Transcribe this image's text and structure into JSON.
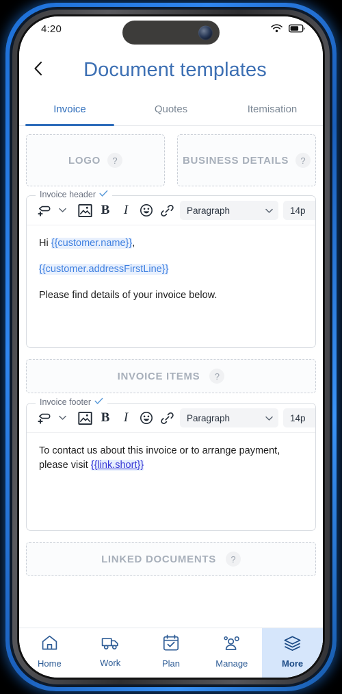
{
  "status_bar": {
    "time": "4:20",
    "wifi_icon": "wifi-icon",
    "battery_icon": "battery-icon"
  },
  "header": {
    "back_icon": "chevron-left-icon",
    "title": "Document templates"
  },
  "tabs": [
    {
      "label": "Invoice",
      "active": true
    },
    {
      "label": "Quotes",
      "active": false
    },
    {
      "label": "Itemisation",
      "active": false
    }
  ],
  "sections": {
    "logo": {
      "label": "LOGO",
      "help": "?"
    },
    "business_details": {
      "label": "BUSINESS DETAILS",
      "help": "?"
    },
    "invoice_items": {
      "label": "INVOICE ITEMS",
      "help": "?"
    },
    "linked_documents": {
      "label": "LINKED DOCUMENTS",
      "help": "?"
    }
  },
  "editors": [
    {
      "legend": "Invoice header",
      "legend_icon": "check-icon",
      "toolbar": {
        "merge_tag_icon": "tag-plus-icon",
        "merge_tag_chevron": "chevron-down-icon",
        "image_icon": "image-icon",
        "bold_label": "B",
        "italic_label": "I",
        "emoji_icon": "smiley-icon",
        "link_icon": "link-icon",
        "style_value": "Paragraph",
        "style_chevron": "chevron-down-icon",
        "font_size_value": "14p"
      },
      "body": {
        "line1_prefix": "Hi ",
        "line1_tag": "{{customer.name}}",
        "line1_suffix": ",",
        "line2_tag": "{{customer.addressFirstLine}}",
        "line3": "Please find details of your invoice below."
      }
    },
    {
      "legend": "Invoice footer",
      "legend_icon": "check-icon",
      "toolbar": {
        "merge_tag_icon": "tag-plus-icon",
        "merge_tag_chevron": "chevron-down-icon",
        "image_icon": "image-icon",
        "bold_label": "B",
        "italic_label": "I",
        "emoji_icon": "smiley-icon",
        "link_icon": "link-icon",
        "style_value": "Paragraph",
        "style_chevron": "chevron-down-icon",
        "font_size_value": "14p"
      },
      "body": {
        "line1": "To contact us about this invoice or to arrange payment, please visit ",
        "line1_tag": "{{link.short}}"
      }
    }
  ],
  "bottom_nav": [
    {
      "label": "Home",
      "icon": "home-icon",
      "active": false
    },
    {
      "label": "Work",
      "icon": "truck-icon",
      "active": false
    },
    {
      "label": "Plan",
      "icon": "calendar-check-icon",
      "active": false
    },
    {
      "label": "Manage",
      "icon": "people-icon",
      "active": false
    },
    {
      "label": "More",
      "icon": "layers-icon",
      "active": true
    }
  ],
  "colors": {
    "accent_blue": "#2e6dbb",
    "title_blue": "#3c6fb3",
    "nav_active_bg": "#d6e6fb",
    "tag_blue": "#3d7fe0",
    "placeholder_gray": "#a7afba"
  }
}
